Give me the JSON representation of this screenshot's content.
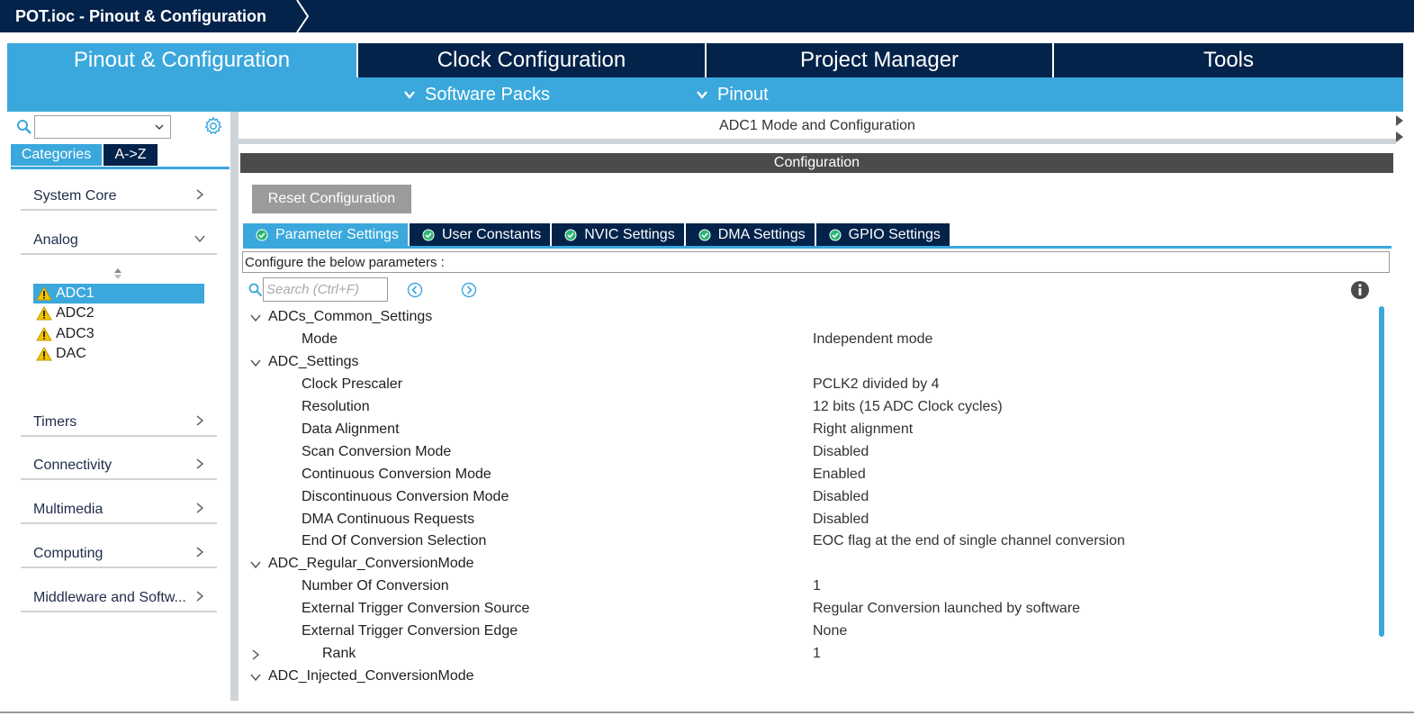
{
  "window": {
    "title": "POT.ioc - Pinout & Configuration"
  },
  "main_tabs": [
    {
      "label": "Pinout & Configuration",
      "active": true
    },
    {
      "label": "Clock Configuration",
      "active": false
    },
    {
      "label": "Project Manager",
      "active": false
    },
    {
      "label": "Tools",
      "active": false
    }
  ],
  "sub_menu": {
    "software_packs": "Software Packs",
    "pinout": "Pinout"
  },
  "left": {
    "search_value": "",
    "tabs": {
      "categories": "Categories",
      "atoz": "A->Z"
    },
    "categories": [
      {
        "label": "System Core",
        "expanded": false
      },
      {
        "label": "Analog",
        "expanded": true
      },
      {
        "label": "Timers",
        "expanded": false
      },
      {
        "label": "Connectivity",
        "expanded": false
      },
      {
        "label": "Multimedia",
        "expanded": false
      },
      {
        "label": "Computing",
        "expanded": false
      },
      {
        "label": "Middleware and Softw...",
        "expanded": false
      }
    ],
    "analog_items": [
      {
        "label": "ADC1",
        "selected": true,
        "warning": true
      },
      {
        "label": "ADC2",
        "selected": false,
        "warning": true
      },
      {
        "label": "ADC3",
        "selected": false,
        "warning": true
      },
      {
        "label": "DAC",
        "selected": false,
        "warning": true
      }
    ]
  },
  "right": {
    "mode_title": "ADC1 Mode and Configuration",
    "config_header": "Configuration",
    "reset_button": "Reset Configuration",
    "param_tabs": [
      {
        "label": "Parameter Settings",
        "active": true
      },
      {
        "label": "User Constants",
        "active": false
      },
      {
        "label": "NVIC Settings",
        "active": false
      },
      {
        "label": "DMA Settings",
        "active": false
      },
      {
        "label": "GPIO Settings",
        "active": false
      }
    ],
    "configure_text": "Configure the below parameters :",
    "search_placeholder": "Search (Ctrl+F)",
    "params": [
      {
        "type": "group",
        "label": "ADCs_Common_Settings",
        "expanded": true
      },
      {
        "type": "param",
        "key": "Mode",
        "value": "Independent mode"
      },
      {
        "type": "group",
        "label": "ADC_Settings",
        "expanded": true
      },
      {
        "type": "param",
        "key": "Clock Prescaler",
        "value": "PCLK2 divided by 4"
      },
      {
        "type": "param",
        "key": "Resolution",
        "value": "12 bits (15 ADC Clock cycles)"
      },
      {
        "type": "param",
        "key": "Data Alignment",
        "value": "Right alignment"
      },
      {
        "type": "param",
        "key": "Scan Conversion Mode",
        "value": "Disabled"
      },
      {
        "type": "param",
        "key": "Continuous Conversion Mode",
        "value": "Enabled"
      },
      {
        "type": "param",
        "key": "Discontinuous Conversion Mode",
        "value": "Disabled"
      },
      {
        "type": "param",
        "key": "DMA Continuous Requests",
        "value": "Disabled"
      },
      {
        "type": "param",
        "key": "End Of Conversion Selection",
        "value": "EOC flag at the end of single channel conversion"
      },
      {
        "type": "group",
        "label": "ADC_Regular_ConversionMode",
        "expanded": true
      },
      {
        "type": "param",
        "key": "Number Of Conversion",
        "value": "1"
      },
      {
        "type": "param",
        "key": "External Trigger Conversion Source",
        "value": "Regular Conversion launched by software"
      },
      {
        "type": "param",
        "key": "External Trigger Conversion Edge",
        "value": "None"
      },
      {
        "type": "subgroup",
        "key": "Rank",
        "value": "1",
        "expanded": false
      },
      {
        "type": "group",
        "label": "ADC_Injected_ConversionMode",
        "expanded": true
      }
    ]
  },
  "colors": {
    "navy": "#03234b",
    "accent": "#3aa8dc",
    "config_bar": "#4b4b4b",
    "reset_button": "#9b9b9b",
    "warning": "#f5c400"
  }
}
